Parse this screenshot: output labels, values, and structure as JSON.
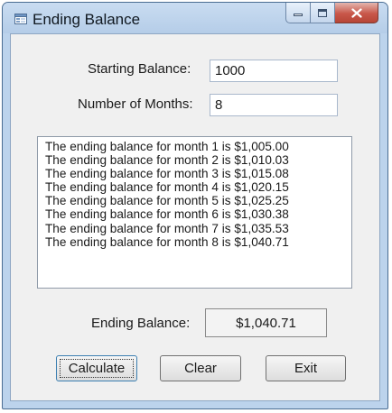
{
  "window": {
    "title": "Ending Balance",
    "icons": {
      "app": "form-icon",
      "minimize": "minimize-icon",
      "maximize": "maximize-icon",
      "close": "close-icon"
    }
  },
  "form": {
    "starting_balance_label": "Starting Balance:",
    "starting_balance_value": "1000",
    "months_label": "Number of Months:",
    "months_value": "8",
    "results": [
      "The ending balance for month 1 is $1,005.00",
      "The ending balance for month 2 is $1,010.03",
      "The ending balance for month 3 is $1,015.08",
      "The ending balance for month 4 is $1,020.15",
      "The ending balance for month 5 is $1,025.25",
      "The ending balance for month 6 is $1,030.38",
      "The ending balance for month 7 is $1,035.53",
      "The ending balance for month 8 is $1,040.71"
    ],
    "ending_balance_label": "Ending Balance:",
    "ending_balance_value": "$1,040.71"
  },
  "buttons": {
    "calculate": "Calculate",
    "clear": "Clear",
    "exit": "Exit"
  },
  "colors": {
    "frame": "#bcd3ec",
    "client": "#f0f0f0",
    "close_button": "#c9574a"
  }
}
